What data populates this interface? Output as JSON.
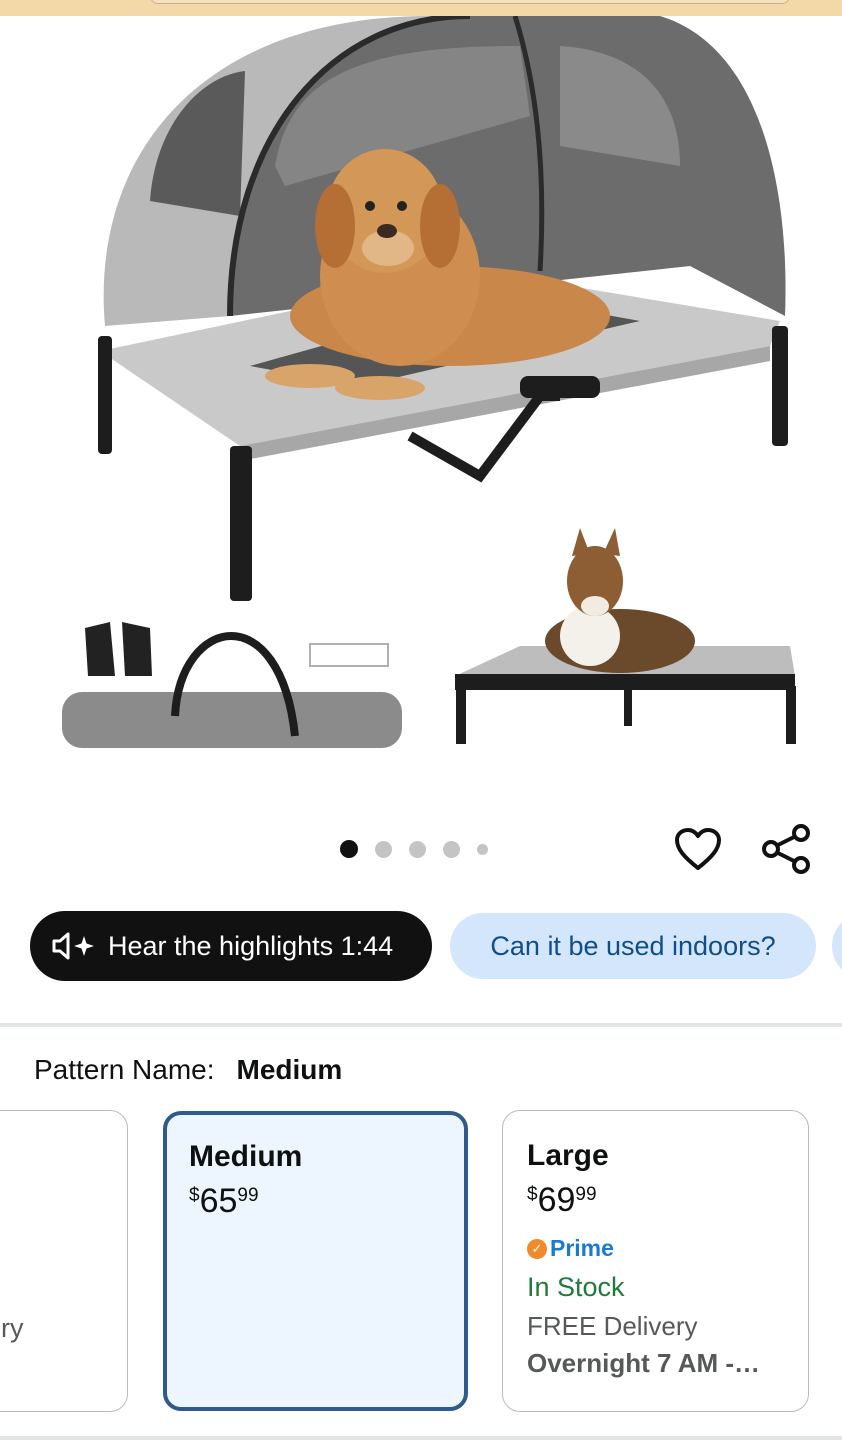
{
  "gallery": {
    "image_alt": "Elevated dog bed with canopy",
    "dot_count": 5,
    "active_index": 0
  },
  "actions": {
    "favorite_icon": "heart-icon",
    "share_icon": "share-icon"
  },
  "chips": {
    "audio_label": "Hear the highlights 1:44",
    "question_label": "Can it be used indoors?"
  },
  "pattern": {
    "label": "Pattern Name:",
    "value": "Medium"
  },
  "variants": {
    "left_partial_text": "ry",
    "medium": {
      "name": "Medium",
      "currency": "$",
      "whole": "65",
      "cents": "99"
    },
    "large": {
      "name": "Large",
      "currency": "$",
      "whole": "69",
      "cents": "99",
      "prime": "Prime",
      "stock": "In Stock",
      "delivery": "FREE Delivery",
      "overnight": "Overnight 7 AM -…"
    }
  },
  "colors": {
    "accent_blue": "#2e5b8c",
    "chip_blue": "#d4e6fb",
    "in_stock_green": "#1f7a3c",
    "prime_blue": "#1a7ad1"
  }
}
